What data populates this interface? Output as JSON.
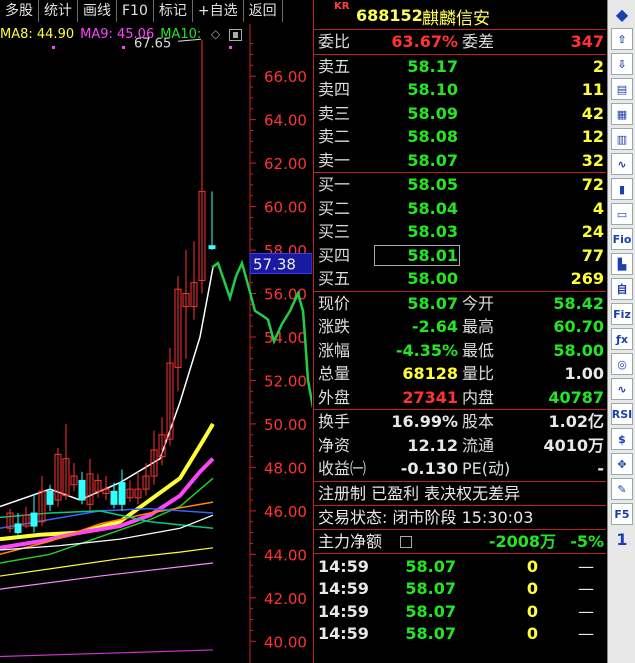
{
  "toolbar": [
    "多股",
    "统计",
    "画线",
    "F10",
    "标记",
    "+自选",
    "返回"
  ],
  "ma_legend": [
    {
      "label": "MA8: 44.90",
      "color": "#ffff33"
    },
    {
      "label": "MA9: 45.06",
      "color": "#ff44ff"
    },
    {
      "label": "MA10:",
      "color": "#22e622"
    }
  ],
  "chart_data": {
    "type": "candlestick",
    "y_ticks": [
      "66.00",
      "64.00",
      "62.00",
      "60.00",
      "58.00",
      "56.00",
      "54.00",
      "52.00",
      "50.00",
      "48.00",
      "46.00",
      "44.00",
      "42.00",
      "40.00"
    ],
    "ylim": [
      39,
      68.4
    ],
    "high_label": "67.65",
    "price_tag": "57.38"
  },
  "stock": {
    "badge": "KR",
    "code": "688152",
    "name": "麒麟信安"
  },
  "weibi": {
    "label": "委比",
    "value": "63.67%",
    "label2": "委差",
    "value2": "347"
  },
  "asks": [
    {
      "label": "卖五",
      "price": "58.17",
      "vol": "2"
    },
    {
      "label": "卖四",
      "price": "58.10",
      "vol": "11"
    },
    {
      "label": "卖三",
      "price": "58.09",
      "vol": "42"
    },
    {
      "label": "卖二",
      "price": "58.08",
      "vol": "12"
    },
    {
      "label": "卖一",
      "price": "58.07",
      "vol": "32"
    }
  ],
  "bids": [
    {
      "label": "买一",
      "price": "58.05",
      "vol": "72"
    },
    {
      "label": "买二",
      "price": "58.04",
      "vol": "4"
    },
    {
      "label": "买三",
      "price": "58.03",
      "vol": "24"
    },
    {
      "label": "买四",
      "price": "58.01",
      "vol": "77"
    },
    {
      "label": "买五",
      "price": "58.00",
      "vol": "269"
    }
  ],
  "stats": [
    {
      "l1": "现价",
      "v1": "58.07",
      "c1": "green",
      "l2": "今开",
      "v2": "58.42",
      "c2": "green"
    },
    {
      "l1": "涨跌",
      "v1": "-2.64",
      "c1": "green",
      "l2": "最高",
      "v2": "60.70",
      "c2": "green"
    },
    {
      "l1": "涨幅",
      "v1": "-4.35%",
      "c1": "green",
      "l2": "最低",
      "v2": "58.00",
      "c2": "green"
    },
    {
      "l1": "总量",
      "v1": "68128",
      "c1": "yellow",
      "l2": "量比",
      "v2": "1.00",
      "c2": "white"
    },
    {
      "l1": "外盘",
      "v1": "27341",
      "c1": "red",
      "l2": "内盘",
      "v2": "40787",
      "c2": "green"
    }
  ],
  "fundamentals": [
    {
      "l1": "换手",
      "v1": "16.99%",
      "l2": "股本",
      "v2": "1.02亿"
    },
    {
      "l1": "净资",
      "v1": "12.12",
      "l2": "流通",
      "v2": "4010万"
    },
    {
      "l1": "收益㈠",
      "v1": "-0.130",
      "l2": "PE(动)",
      "v2": "-"
    }
  ],
  "tags": "注册制 已盈利 表决权无差异",
  "trade_status": "交易状态: 闭市阶段 15:30:03",
  "main_flow": {
    "label": "主力净额",
    "value": "-2008万",
    "pct": "-5%"
  },
  "ticks": [
    {
      "time": "14:59",
      "price": "58.07",
      "vol": "0",
      "flag": "—"
    },
    {
      "time": "14:59",
      "price": "58.07",
      "vol": "0",
      "flag": "—"
    },
    {
      "time": "14:59",
      "price": "58.07",
      "vol": "0",
      "flag": "—"
    },
    {
      "time": "14:59",
      "price": "58.07",
      "vol": "0",
      "flag": "—"
    }
  ],
  "side_icons": [
    "◆",
    "⇧",
    "⇩",
    "▤",
    "▦",
    "▥",
    "∿",
    "▮",
    "▭",
    "Fio",
    "▙",
    "自",
    "Fiz",
    "ƒx",
    "◎",
    "∿",
    "RSI",
    "$",
    "✥",
    "✎",
    "F5",
    "1"
  ]
}
